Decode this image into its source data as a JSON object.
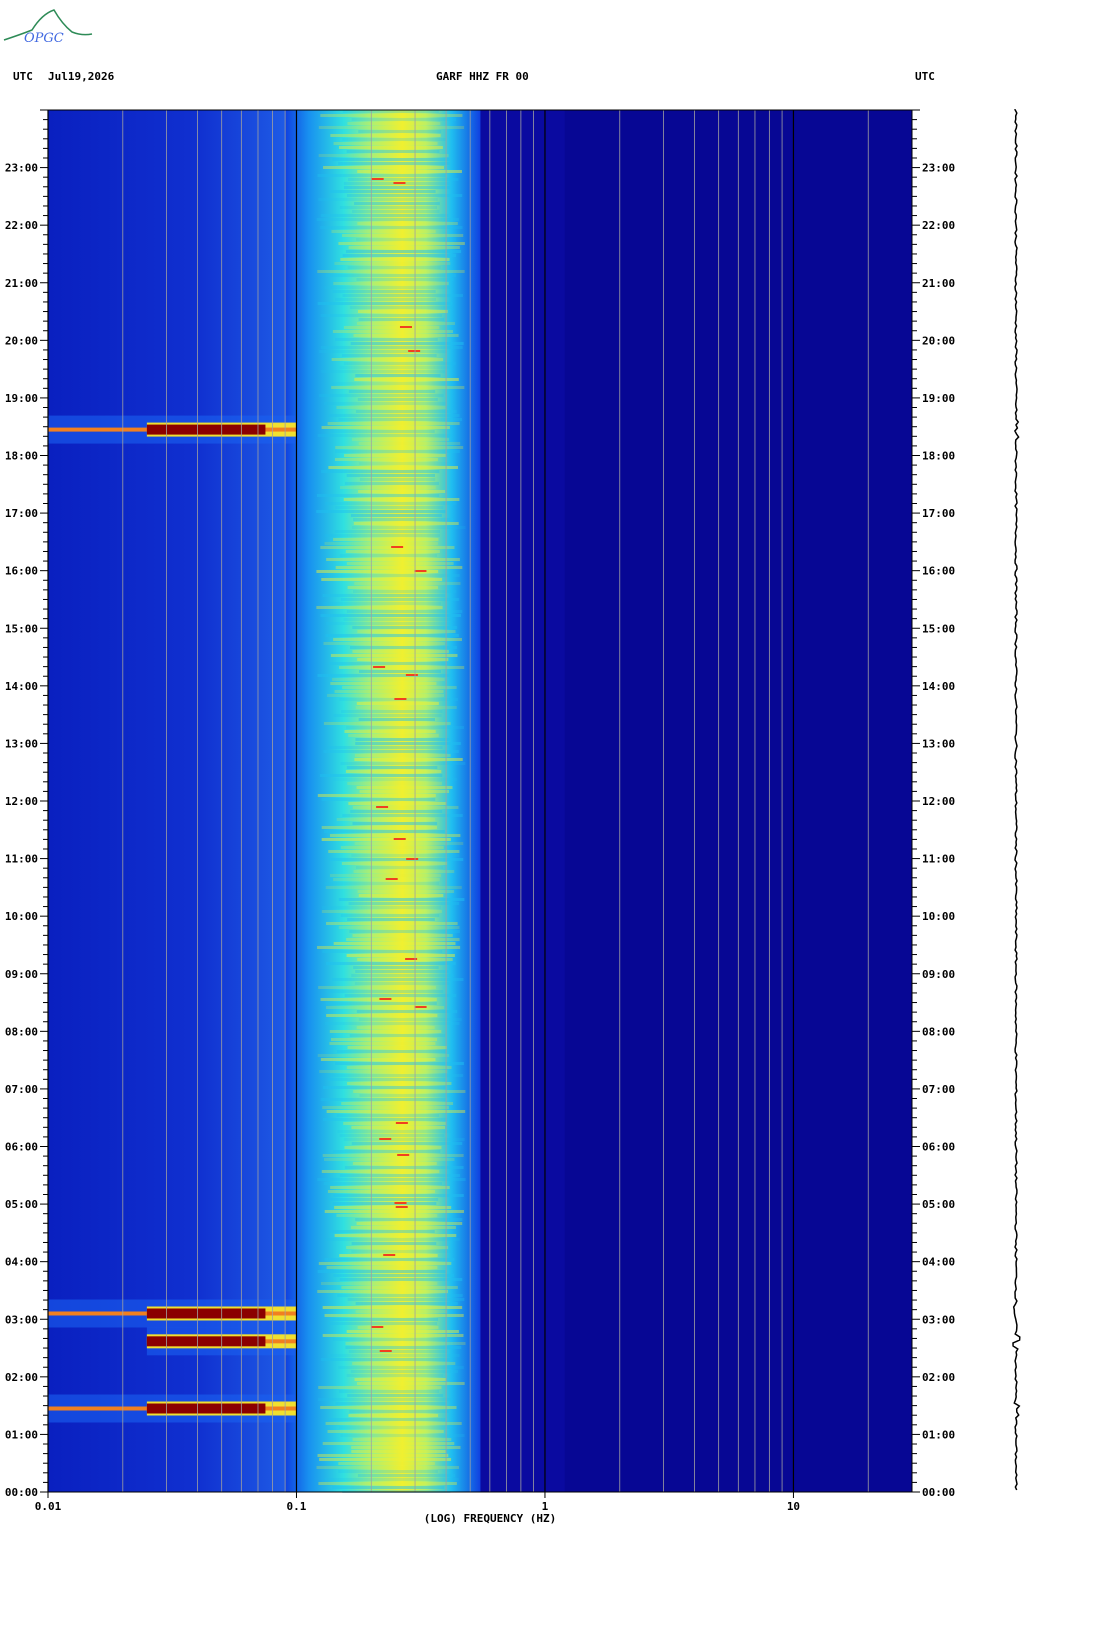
{
  "header": {
    "tz_left": "UTC",
    "date": "Jul19,2026",
    "station": "GARF HHZ FR 00",
    "tz_right": "UTC"
  },
  "logo": {
    "text": "OPGC"
  },
  "colors": {
    "background": "#0a0aa0",
    "ridge": "#f0f030",
    "event": "#8b0000",
    "gridline_light": "#a0a0a0",
    "gridline_dark": "#000000"
  },
  "chart_data": {
    "type": "heatmap",
    "title": "GARF HHZ FR 00",
    "xlabel": "(LOG) FREQUENCY (HZ)",
    "ylabel": "UTC",
    "x_scale": "log",
    "xlim": [
      0.01,
      30
    ],
    "x_ticks": [
      {
        "value": 0.01,
        "label": "0.01"
      },
      {
        "value": 0.1,
        "label": "0.1"
      },
      {
        "value": 1,
        "label": "1"
      },
      {
        "value": 10,
        "label": "10"
      }
    ],
    "y_ticks": [
      "00:00",
      "01:00",
      "02:00",
      "03:00",
      "04:00",
      "05:00",
      "06:00",
      "07:00",
      "08:00",
      "09:00",
      "10:00",
      "11:00",
      "12:00",
      "13:00",
      "14:00",
      "15:00",
      "16:00",
      "17:00",
      "18:00",
      "19:00",
      "20:00",
      "21:00",
      "22:00",
      "23:00"
    ],
    "ylim_hours": [
      0,
      24
    ],
    "microseism_band_hz": [
      0.18,
      0.35
    ],
    "microseism_peak_hz": 0.27,
    "events": [
      {
        "time_utc": "01:27",
        "f_min_hz": 0.01,
        "f_max_hz": 0.1
      },
      {
        "time_utc": "02:37",
        "f_min_hz": 0.025,
        "f_max_hz": 0.1
      },
      {
        "time_utc": "03:06",
        "f_min_hz": 0.01,
        "f_max_hz": 0.1
      },
      {
        "time_utc": "18:27",
        "f_min_hz": 0.01,
        "f_max_hz": 0.1
      }
    ]
  }
}
